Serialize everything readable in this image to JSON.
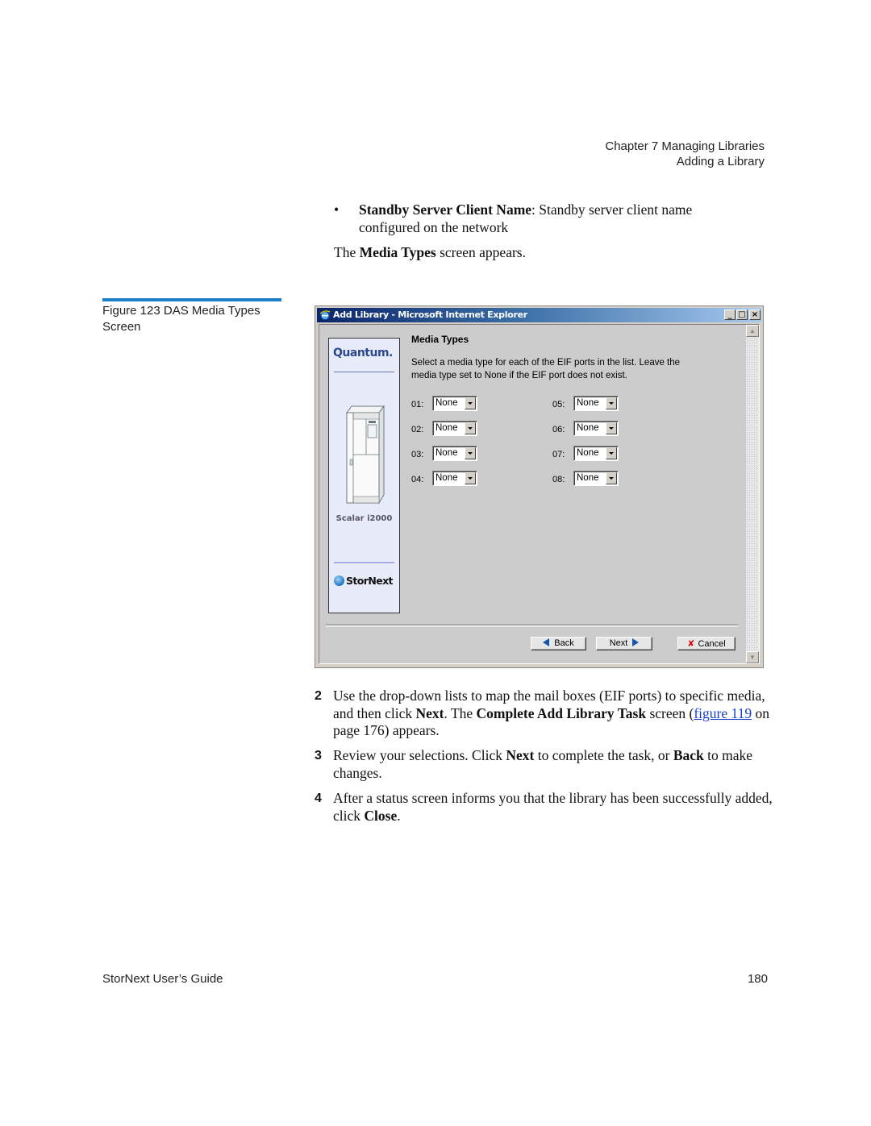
{
  "header": {
    "chapter": "Chapter 7  Managing Libraries",
    "section": "Adding a Library"
  },
  "intro": {
    "bullet_symbol": "•",
    "bullet_bold": "Standby Server Client Name",
    "bullet_rest": ": Standby server client name configured on the network",
    "media_prefix": "The ",
    "media_bold": "Media Types",
    "media_suffix": " screen appears."
  },
  "figure": {
    "caption": "Figure 123  DAS Media Types Screen"
  },
  "window": {
    "title": "Add Library - Microsoft Internet Explorer",
    "controls": {
      "minimize": "_",
      "maximize": "□",
      "close": "×"
    },
    "sidebar": {
      "brand": "Quantum.",
      "product": "Scalar i2000",
      "footer_brand": "StorNext"
    },
    "heading": "Media Types",
    "description": "Select a media type for each of the EIF ports in the list. Leave the media type set to None if the EIF port does not exist.",
    "ports": [
      {
        "label": "01:",
        "value": "None"
      },
      {
        "label": "02:",
        "value": "None"
      },
      {
        "label": "03:",
        "value": "None"
      },
      {
        "label": "04:",
        "value": "None"
      },
      {
        "label": "05:",
        "value": "None"
      },
      {
        "label": "06:",
        "value": "None"
      },
      {
        "label": "07:",
        "value": "None"
      },
      {
        "label": "08:",
        "value": "None"
      }
    ],
    "buttons": {
      "back": "Back",
      "next": "Next",
      "cancel": "Cancel"
    }
  },
  "steps": [
    {
      "num": "2",
      "parts": {
        "a": "Use the drop-down lists to map the mail boxes (EIF ports) to specific media, and then click ",
        "b": "Next",
        "c": ". The ",
        "d": "Complete Add Library Task",
        "e": " screen (",
        "link": "figure 119",
        "f": " on page 176) appears."
      }
    },
    {
      "num": "3",
      "parts": {
        "a": "Review your selections. Click ",
        "b": "Next",
        "c": " to complete the task, or ",
        "d": "Back",
        "e": " to make changes."
      }
    },
    {
      "num": "4",
      "parts": {
        "a": "After a status screen informs you that the library has been successfully added, click ",
        "b": "Close",
        "c": "."
      }
    }
  ],
  "footer": {
    "guide": "StorNext User’s Guide",
    "page": "180"
  }
}
